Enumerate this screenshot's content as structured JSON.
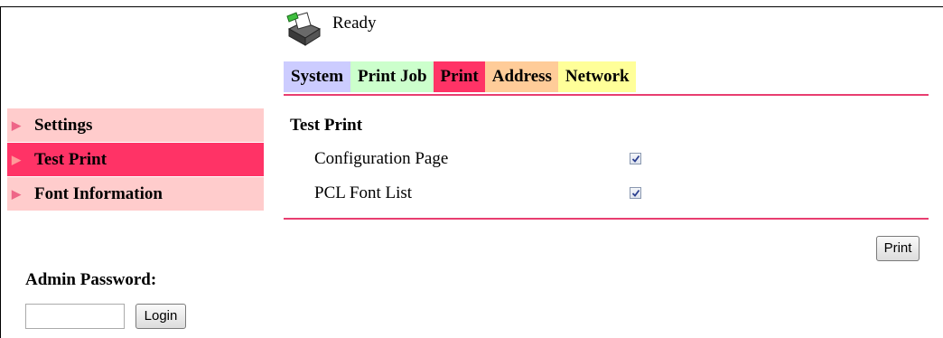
{
  "status": {
    "text": "Ready",
    "icon": "printer-icon"
  },
  "tabs": [
    {
      "label": "System",
      "color": "#ccccff"
    },
    {
      "label": "Print Job",
      "color": "#ccffcc"
    },
    {
      "label": "Print",
      "color": "#ff3366",
      "active": true
    },
    {
      "label": "Address",
      "color": "#ffcc99"
    },
    {
      "label": "Network",
      "color": "#ffff99"
    }
  ],
  "sidebar": {
    "items": [
      {
        "label": "Settings",
        "icon": "triangle-right-icon",
        "active": false
      },
      {
        "label": "Test Print",
        "icon": "triangle-right-icon",
        "active": true
      },
      {
        "label": "Font Information",
        "icon": "triangle-right-icon",
        "active": false
      }
    ]
  },
  "main": {
    "section_title": "Test Print",
    "options": [
      {
        "label": "Configuration Page",
        "checked": true
      },
      {
        "label": "PCL Font List",
        "checked": true
      }
    ],
    "print_button": "Print"
  },
  "admin": {
    "label": "Admin Password:",
    "password_value": "",
    "login_button": "Login"
  },
  "colors": {
    "accent": "#ff3366",
    "rule": "#e83e70",
    "sidebar_bg": "#ffcccc"
  }
}
